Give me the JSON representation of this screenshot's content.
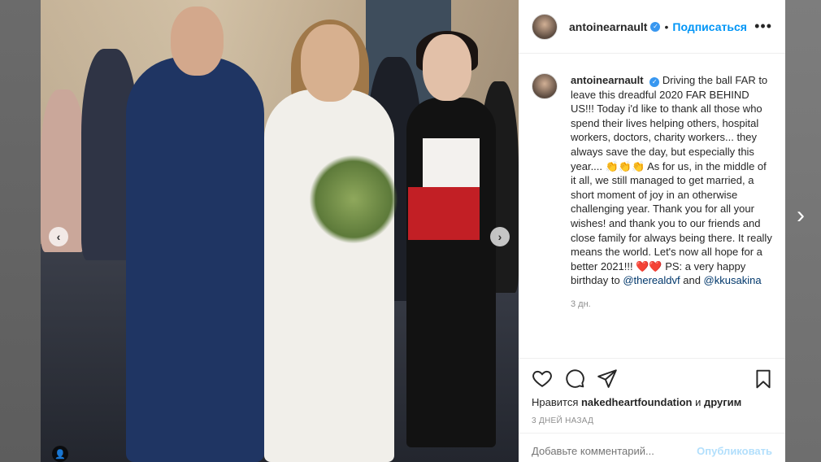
{
  "header": {
    "username": "antoinearnault",
    "separator": "•",
    "follow_label": "Подписаться",
    "more_label": "•••"
  },
  "caption": {
    "username": "antoinearnault",
    "text_part1": "Driving the ball FAR to leave this dreadful 2020 FAR BEHIND US!!! Today i'd like to thank all those who spend their lives helping others, hospital workers, doctors, charity workers... they always save the day, but especially this year.... 👏👏👏 As for us, in the middle of it all, we still managed to get married, a short moment of joy in an otherwise challenging year. Thank you for all your wishes! and thank you to our friends and close family for always being there. It really means the world. Let's now all hope for a better 2021!!! ❤️❤️ PS: a very happy birthday to ",
    "mention1": "@therealdvf",
    "conjunction": " and ",
    "mention2": "@kkusakina",
    "relative_time": "3 дн."
  },
  "likes": {
    "prefix": "Нравится ",
    "user": "nakedheartfoundation",
    "suffix": " и ",
    "others": "другим"
  },
  "post_date": "3 ДНЕЙ НАЗАД",
  "comment": {
    "placeholder": "Добавьте комментарий...",
    "post_label": "Опубликовать"
  },
  "navigation": {
    "prev_glyph": "‹",
    "next_glyph": "›",
    "next_post_glyph": "›",
    "user_tag_glyph": "👤"
  },
  "colors": {
    "accent": "#0095f6",
    "verified": "#3897f0",
    "mention": "#00376b",
    "muted": "#8e8e8e"
  },
  "icons": [
    "heart-icon",
    "comment-icon",
    "share-icon",
    "bookmark-icon",
    "verified-badge-icon",
    "more-options-icon"
  ]
}
